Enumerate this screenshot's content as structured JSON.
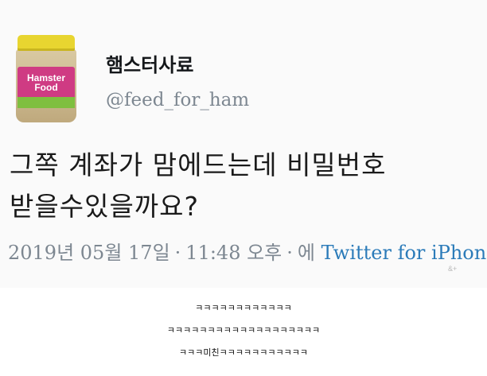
{
  "tweet": {
    "display_name": "햄스터사료",
    "handle": "@feed_for_ham",
    "avatar_label": "Hamster Food",
    "text_lines": [
      "그쪽 계좌가 맘에드는데 비밀번호",
      "받을수있을까요?"
    ],
    "date": "2019년 05월 17일",
    "time": "11:48 오후",
    "via": "에",
    "source": "Twitter for iPhone",
    "separator": "·"
  },
  "watermark": "&+",
  "comments": [
    "ㅋㅋㅋㅋㅋㅋㅋㅋㅋㅋㅋㅋ",
    "ㅋㅋㅋㅋㅋㅋㅋㅋㅋㅋㅋㅋㅋㅋㅋㅋㅋㅋㅋ",
    "ㅋㅋㅋ미친ㅋㅋㅋㅋㅋㅋㅋㅋㅋㅋㅋ"
  ],
  "colors": {
    "background": "#fafafa",
    "secondary_text": "#7d8791",
    "link": "#2b7bb9",
    "jar_lid": "#e8d530",
    "jar_label": "#cf3b83"
  }
}
